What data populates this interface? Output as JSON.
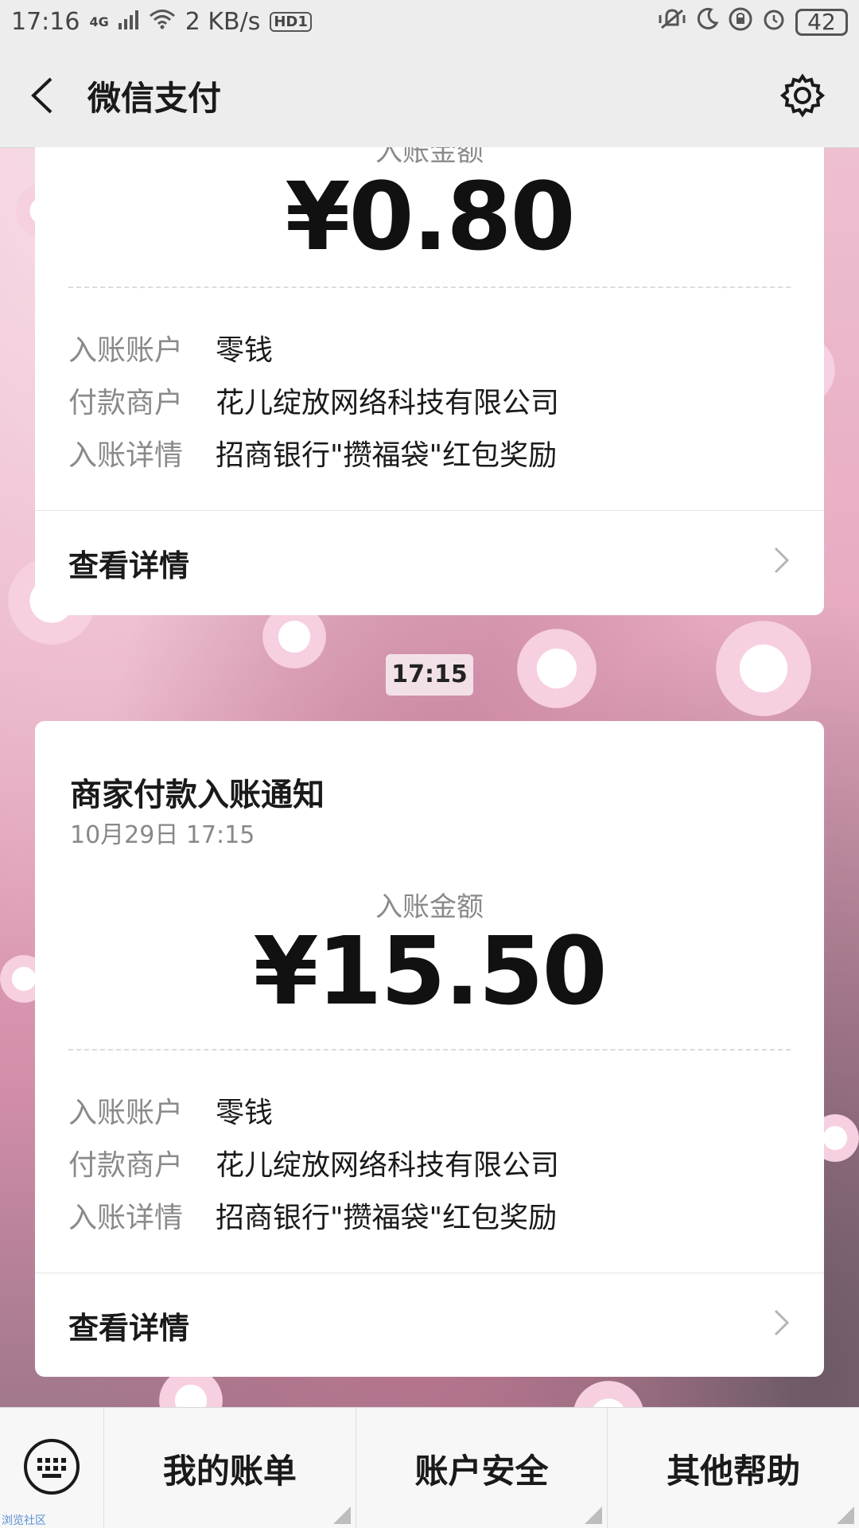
{
  "status_bar": {
    "time": "17:16",
    "network": "4G",
    "speed": "2 KB/s",
    "hd": "HD1",
    "battery": "42"
  },
  "header": {
    "title": "微信支付"
  },
  "messages": [
    {
      "amount_label": "入账金额",
      "amount": "¥0.80",
      "rows": [
        {
          "key": "入账账户",
          "value": "零钱"
        },
        {
          "key": "付款商户",
          "value": "花儿绽放网络科技有限公司"
        },
        {
          "key": "入账详情",
          "value": "招商银行\"攒福袋\"红包奖励"
        }
      ],
      "detail_link": "查看详情"
    },
    {
      "timestamp_chip": "17:15",
      "title": "商家付款入账通知",
      "date": "10月29日  17:15",
      "amount_label": "入账金额",
      "amount": "¥15.50",
      "rows": [
        {
          "key": "入账账户",
          "value": "零钱"
        },
        {
          "key": "付款商户",
          "value": "花儿绽放网络科技有限公司"
        },
        {
          "key": "入账详情",
          "value": "招商银行\"攒福袋\"红包奖励"
        }
      ],
      "detail_link": "查看详情"
    }
  ],
  "bottom_menu": {
    "items": [
      "我的账单",
      "账户安全",
      "其他帮助"
    ]
  },
  "watermark": "浏览社区"
}
